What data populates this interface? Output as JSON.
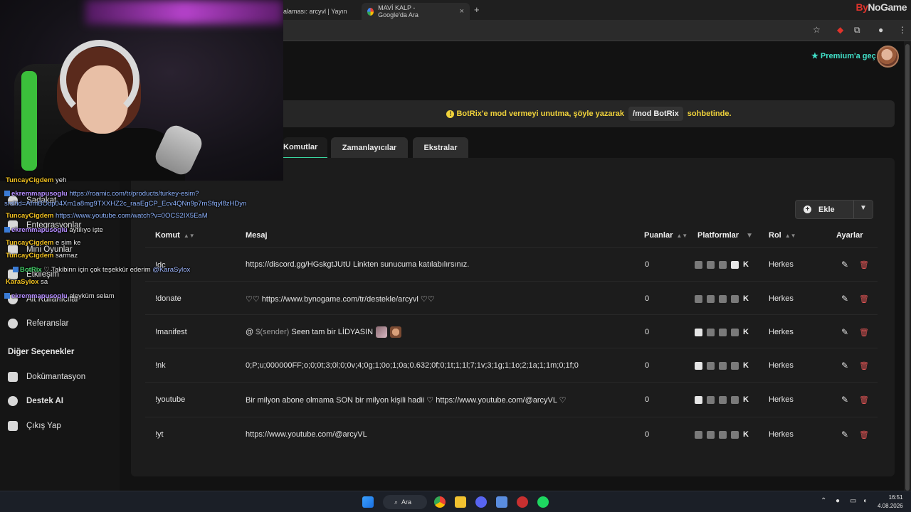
{
  "browser": {
    "tabs": [
      {
        "label": "alaması: arcyvl | Yayın"
      },
      {
        "label": "MAVİ KALP - Google'da Ara"
      }
    ],
    "new_tab_glyph": "+",
    "close_glyph": "×",
    "brand": {
      "prefix": "By",
      "rest": "NoGame"
    }
  },
  "header": {
    "premium_label": "Premium'a geç"
  },
  "notice": {
    "before": "BotRix'e mod vermeyi unutma, şöyle yazarak",
    "command": "/mod BotRix",
    "after": "sohbetinde."
  },
  "tabs": [
    {
      "label": "Komutlar"
    },
    {
      "label": "Zamanlayıcılar"
    },
    {
      "label": "Ekstralar"
    }
  ],
  "add_button": {
    "label": "Ekle"
  },
  "table": {
    "headers": {
      "command": "Komut",
      "message": "Mesaj",
      "points": "Puanlar",
      "platforms": "Platformlar",
      "role": "Rol",
      "settings": "Ayarlar"
    },
    "rows": [
      {
        "command": "!dc",
        "message": "https://discord.gg/HGskgtJUtU Linkten sunucuma katılabılırsınız.",
        "points": "0",
        "role": "Herkes"
      },
      {
        "command": "!donate",
        "message": "♡♡ https://www.bynogame.com/tr/destekle/arcyvl ♡♡",
        "points": "0",
        "role": "Herkes"
      },
      {
        "command": "!manifest",
        "message_prefix": "@ ",
        "message_sender": "$(sender)",
        "message": " Seen tam bir LİDYASIN",
        "points": "0",
        "role": "Herkes"
      },
      {
        "command": "!nk",
        "message": "0;P;u;000000FF;o;0;0t;3;0l;0;0v;4;0g;1;0o;1;0a;0.632;0f;0;1t;1;1l;7;1v;3;1g;1;1o;2;1a;1;1m;0;1f;0",
        "points": "0",
        "role": "Herkes"
      },
      {
        "command": "!youtube",
        "message": "Bir milyon abone olmama SON bir milyon kişili hadii ♡ https://www.youtube.com/@arcyVL ♡",
        "points": "0",
        "role": "Herkes"
      },
      {
        "command": "!yt",
        "message": "https://www.youtube.com/@arcyVL",
        "points": "0",
        "role": "Herkes"
      }
    ]
  },
  "sidebar": {
    "items": [
      {
        "label": "Sadakat"
      },
      {
        "label": "Entegrasyonlar"
      },
      {
        "label": "Mini Oyunlar"
      },
      {
        "label": "Etkileşim"
      },
      {
        "label": "Alt Kullanıcılar"
      },
      {
        "label": "Referanslar"
      }
    ],
    "section_header": "Diğer Seçenekler",
    "other_items": [
      {
        "label": "Dokümantasyon"
      },
      {
        "label": "Destek AI"
      },
      {
        "label": "Çıkış Yap"
      }
    ]
  },
  "chat": [
    {
      "nick": "TuncayCigdem",
      "text": "yeh"
    },
    {
      "nick": "ekremmapusoglu",
      "text": "https://roamic.com/tr/products/turkey-esim?"
    },
    {
      "nick": "",
      "text": "srsltid=AfmBOop04Xm1a8mg9TXXHZ2c_raaEgCP_Ecv4QNn9p7mSfqyl8zHDyn"
    },
    {
      "nick": "TuncayCigdem",
      "text": "https://www.youtube.com/watch?v=0OCS2IX5EaM"
    },
    {
      "nick": "ekremmapusoglu",
      "text": "aytılıyo işte"
    },
    {
      "nick": "TuncayCigdem",
      "text": "e sim ke"
    },
    {
      "nick": "TuncayCigdem",
      "text": "sarmaz"
    },
    {
      "nick": "BotRix",
      "text": "♡ Takibinn için çok teşekkür ederim",
      "mention": "@KaraSylox"
    },
    {
      "nick": "KaraSylox",
      "text": "sa"
    },
    {
      "nick": "ekremmapusoglu",
      "text": "aleyküm selam"
    }
  ],
  "taskbar": {
    "search_label": "Ara",
    "time": "16:51",
    "date": "4.08.2026"
  },
  "colors": {
    "accent_teal": "#41e0c8",
    "notice_yellow": "#f0d23b",
    "delete_red": "#e05555",
    "tab_underline": "#3ad6a0"
  }
}
